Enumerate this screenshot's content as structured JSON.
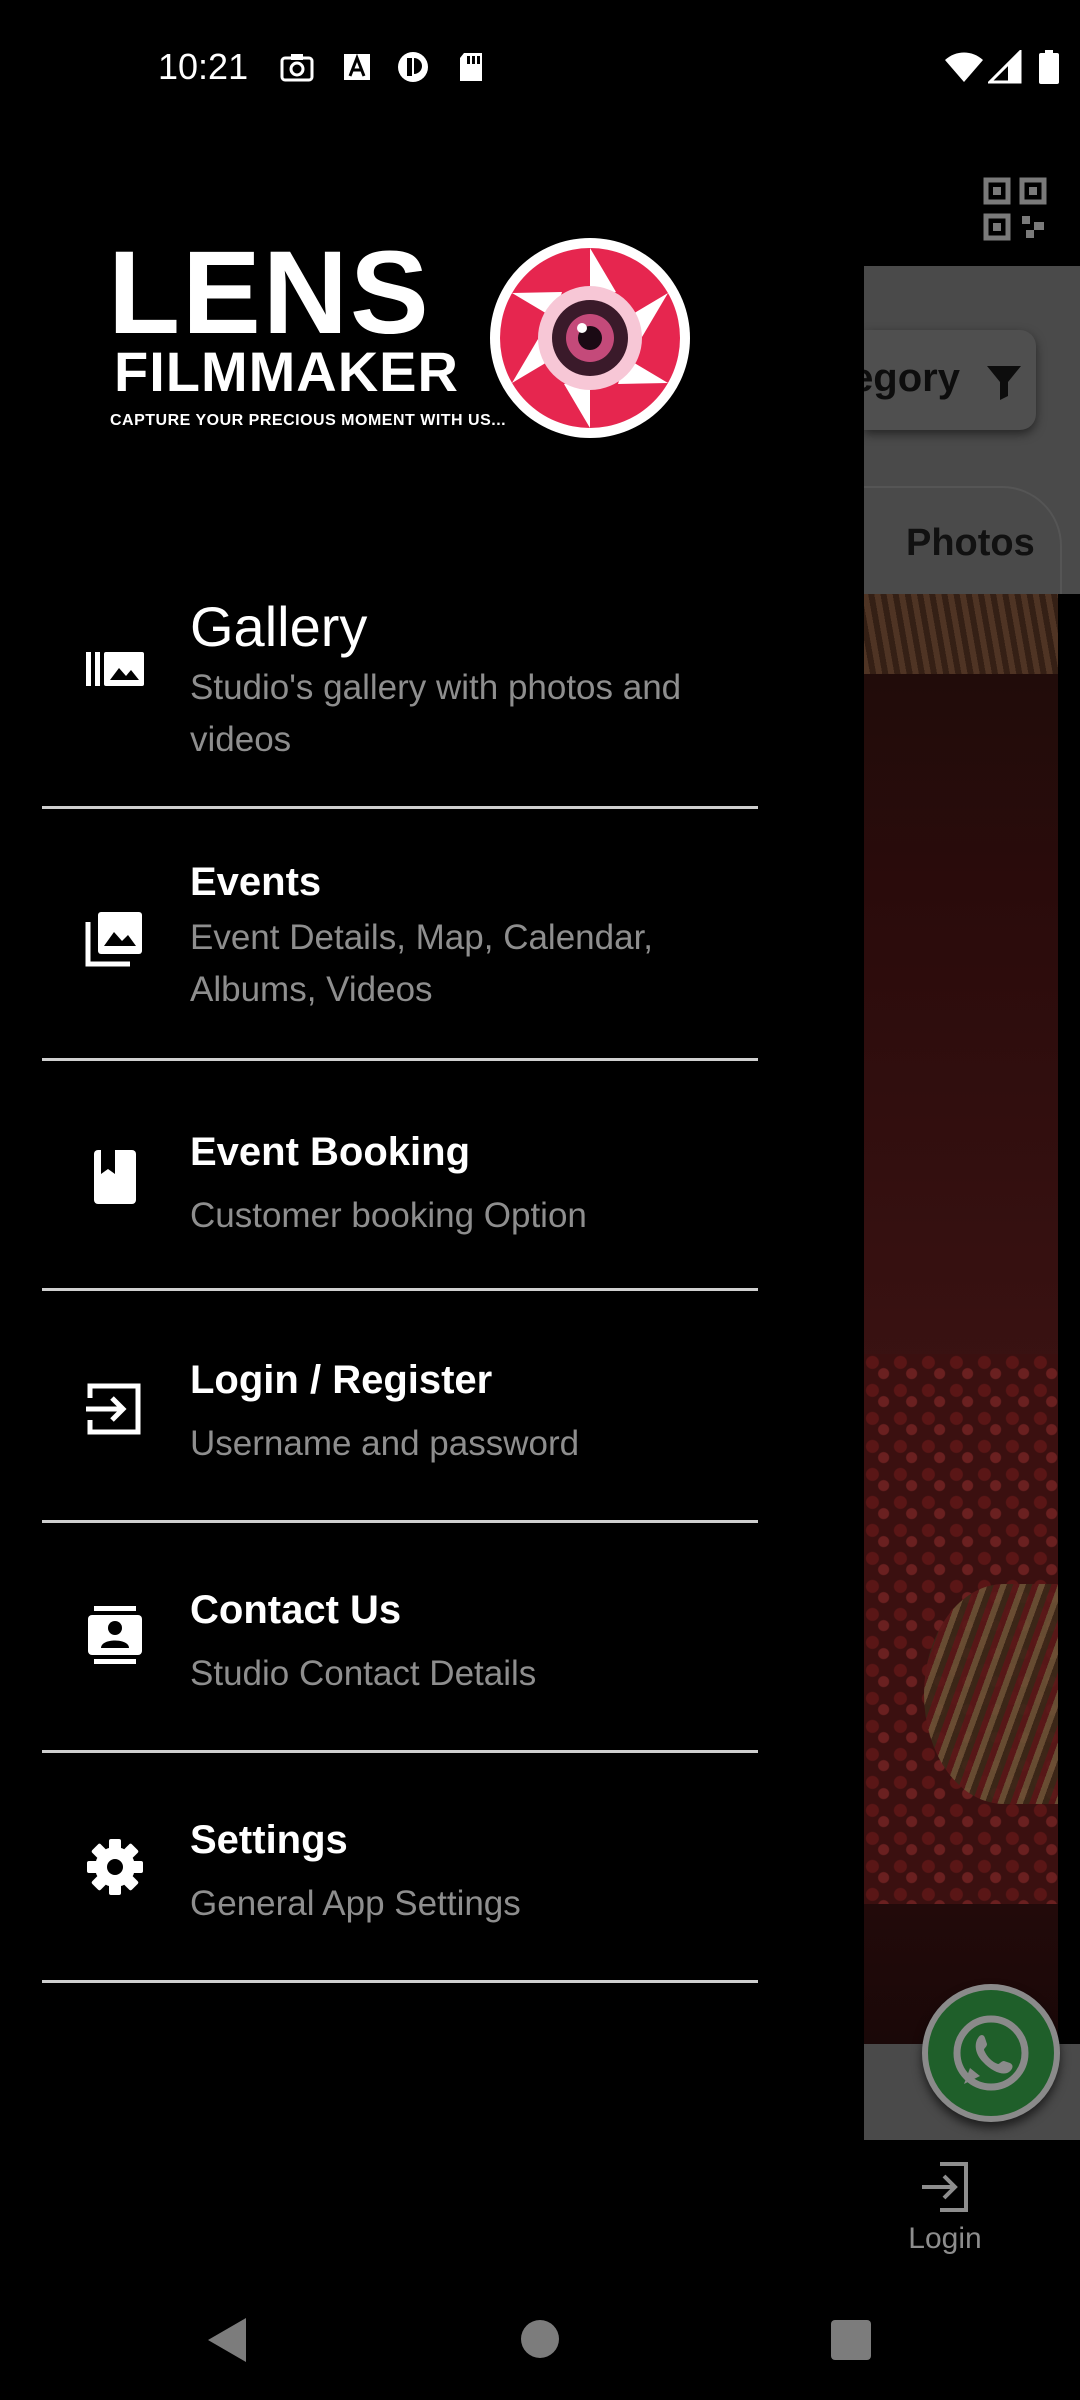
{
  "status_bar": {
    "time": "10:21",
    "left_icons": [
      "camera-icon",
      "font-a-icon",
      "data-saver-icon",
      "sd-card-icon"
    ],
    "right_icons": [
      "wifi-icon",
      "signal-icon",
      "battery-icon"
    ]
  },
  "drawer": {
    "logo": {
      "line1": "LENS",
      "line2": "FILMMAKER",
      "tagline": "CAPTURE YOUR PRECIOUS MOMENT WITH US...",
      "accent_color": "#e6264f"
    },
    "menu": [
      {
        "icon": "gallery-icon",
        "title": "Gallery",
        "subtitle": "Studio's gallery with photos and videos"
      },
      {
        "icon": "photo-library-icon",
        "title": "Events",
        "subtitle": "Event Details, Map, Calendar, Albums, Videos"
      },
      {
        "icon": "book-icon",
        "title": "Event Booking",
        "subtitle": "Customer booking Option"
      },
      {
        "icon": "login-icon",
        "title": "Login / Register",
        "subtitle": "Username and password"
      },
      {
        "icon": "contacts-icon",
        "title": "Contact Us",
        "subtitle": "Studio Contact Details"
      },
      {
        "icon": "gear-icon",
        "title": "Settings",
        "subtitle": "General App Settings"
      }
    ]
  },
  "background_app": {
    "category_chip_label": "egory",
    "photos_tab_label": "Photos",
    "bottom_nav_login_label": "Login"
  },
  "colors": {
    "background": "#000000",
    "text_primary": "#ffffff",
    "text_secondary": "#8e8e8e",
    "divider": "#cfcfcf"
  }
}
